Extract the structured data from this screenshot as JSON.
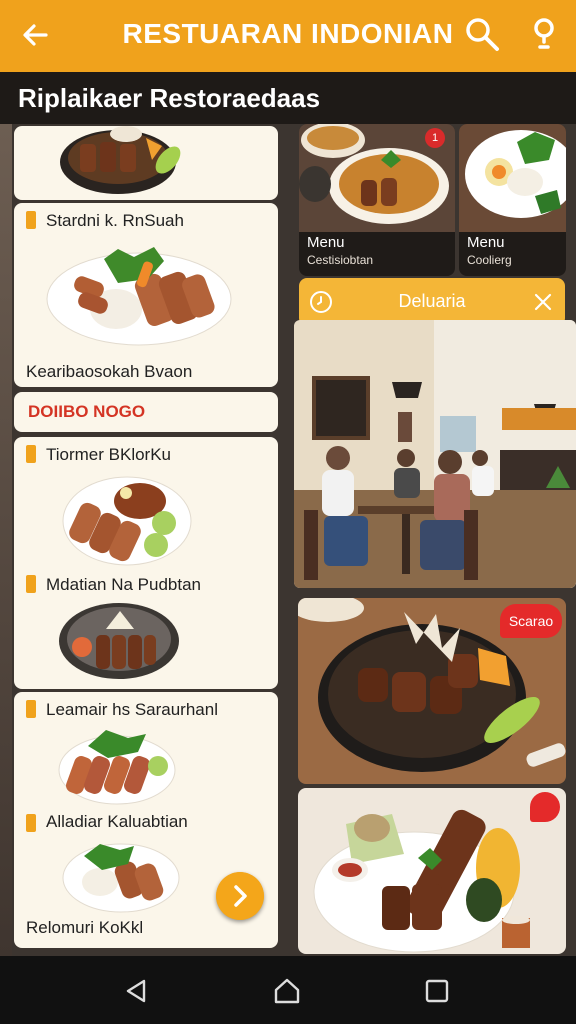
{
  "app": {
    "title": "RESTUARAN INDONIAN",
    "subtitle": "Riplaikaer Restoraedaas"
  },
  "colors": {
    "accent": "#f0a21c",
    "dark": "#1e1a17",
    "promo": "#d43424"
  },
  "left_cards": [
    {
      "label": "",
      "caption": ""
    },
    {
      "label": "Stardni k. RnSuah",
      "caption": "Kearibaosokah Bvaon"
    },
    {
      "label": "Tiormer BKlorKu",
      "caption": "Mdatian Na Pudbtan"
    },
    {
      "label": "Leamair hs Saraurhanl",
      "caption": "Alladiar Kaluabtian"
    },
    {
      "label": "",
      "caption": "Relomuri KoKkl"
    }
  ],
  "promo_text": "DOIIBO NOGO",
  "right_menu": [
    {
      "title": "Menu",
      "sub": "Cestisiobtan",
      "badge": "1"
    },
    {
      "title": "Menu",
      "sub": "Coolierg",
      "badge": ""
    }
  ],
  "delivery_label": "Deluaria",
  "special_badge": "Scarao",
  "icons": {
    "back": "arrow-left-icon",
    "search": "search-icon",
    "help": "lightbulb-icon",
    "fab": "chevron-right-icon",
    "close": "close-icon",
    "delivery": "clock-icon",
    "nav_back": "triangle-back-icon",
    "nav_home": "home-icon",
    "nav_recent": "square-recent-icon"
  }
}
